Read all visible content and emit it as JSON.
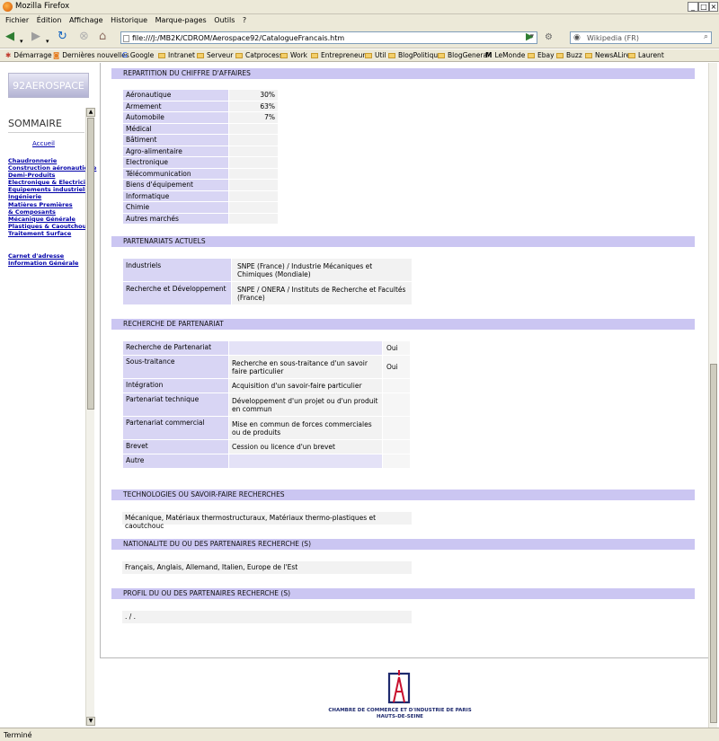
{
  "window": {
    "title": "Mozilla Firefox"
  },
  "menu": [
    "Fichier",
    "Édition",
    "Affichage",
    "Historique",
    "Marque-pages",
    "Outils",
    "?"
  ],
  "nav": {
    "url": "file:///J:/MB2K/CDROM/Aerospace92/CatalogueFrancais.htm",
    "search_placeholder": "Wikipedia (FR)"
  },
  "bookmarks": [
    "Démarrage",
    "Dernières nouvelles",
    "Google",
    "Intranet",
    "Serveur",
    "Catprocess",
    "Work",
    "Entrepreneur",
    "Util",
    "BlogPolitique",
    "BlogGeneral",
    "LeMonde",
    "Ebay",
    "Buzz",
    "NewsALire",
    "Laurent"
  ],
  "status": "Terminé",
  "sidebar": {
    "logo": "92AEROSPACE",
    "title": "SOMMAIRE",
    "home": "Accueil",
    "links": [
      "Chaudronnerie",
      "Construction aéronautique",
      "Demi-Produits",
      "Electronique & Electricité",
      "Equipements industriels",
      "Ingénierie",
      "Matières Premières & Composants",
      "Mécanique Générale",
      "Plastiques & Caoutchouc",
      "Traitement Surface"
    ],
    "links2": [
      "Carnet d'adresse",
      "Information Générale"
    ]
  },
  "sections": {
    "repartition": {
      "title": "REPARTITION DU CHIFFRE D'AFFAIRES",
      "rows": [
        {
          "label": "Aéronautique",
          "value": "30%"
        },
        {
          "label": "Armement",
          "value": "63%"
        },
        {
          "label": "Automobile",
          "value": "7%"
        },
        {
          "label": "Médical",
          "value": ""
        },
        {
          "label": "Bâtiment",
          "value": ""
        },
        {
          "label": "Agro-alimentaire",
          "value": ""
        },
        {
          "label": "Electronique",
          "value": ""
        },
        {
          "label": "Télécommunication",
          "value": ""
        },
        {
          "label": "Biens d'équipement",
          "value": ""
        },
        {
          "label": "Informatique",
          "value": ""
        },
        {
          "label": "Chimie",
          "value": ""
        },
        {
          "label": "Autres marchés",
          "value": ""
        }
      ]
    },
    "partenariats": {
      "title": "PARTENARIATS ACTUELS",
      "rows": [
        {
          "label": "Industriels",
          "value": "SNPE (France) / Industrie Mécaniques et Chimiques (Mondiale)"
        },
        {
          "label": "Recherche et Développement",
          "value": "SNPE / ONERA / Instituts de Recherche et Facultés (France)"
        }
      ]
    },
    "recherche": {
      "title": "RECHERCHE DE PARTENARIAT",
      "rows": [
        {
          "label": "Recherche de Partenariat",
          "desc": "",
          "answer": "Oui"
        },
        {
          "label": "Sous-traitance",
          "desc": "Recherche en sous-traitance d'un savoir faire particulier",
          "answer": "Oui"
        },
        {
          "label": "Intégration",
          "desc": "Acquisition d'un savoir-faire particulier",
          "answer": ""
        },
        {
          "label": "Partenariat technique",
          "desc": "Développement d'un projet ou d'un produit en commun",
          "answer": ""
        },
        {
          "label": "Partenariat commercial",
          "desc": "Mise en commun de forces commerciales ou de produits",
          "answer": ""
        },
        {
          "label": "Brevet",
          "desc": "Cession ou licence d'un brevet",
          "answer": ""
        },
        {
          "label": "Autre",
          "desc": "",
          "answer": ""
        }
      ]
    },
    "technologies": {
      "title": "TECHNOLOGIES OU SAVOIR-FAIRE RECHERCHES",
      "text": "Mécanique, Matériaux thermostructuraux, Matériaux thermo-plastiques et caoutchouc"
    },
    "nationalite": {
      "title": "NATIONALITE DU OU DES PARTENAIRES RECHERCHE (S)",
      "text": "Français, Anglais, Allemand, Italien, Europe de l'Est"
    },
    "profil": {
      "title": "PROFIL DU OU DES PARTENAIRES RECHERCHE (S)",
      "text": ". / ."
    }
  },
  "footer": {
    "line1": "CHAMBRE DE COMMERCE ET D'INDUSTRIE DE PARIS",
    "line2": "HAUTS-DE-SEINE",
    "logo_color": "#1e2a6e",
    "logo_accent": "#c8102e"
  },
  "colors": {
    "header_band": "#cbc6f2",
    "label_cell": "#d8d5f4",
    "link": "#0000aa"
  }
}
